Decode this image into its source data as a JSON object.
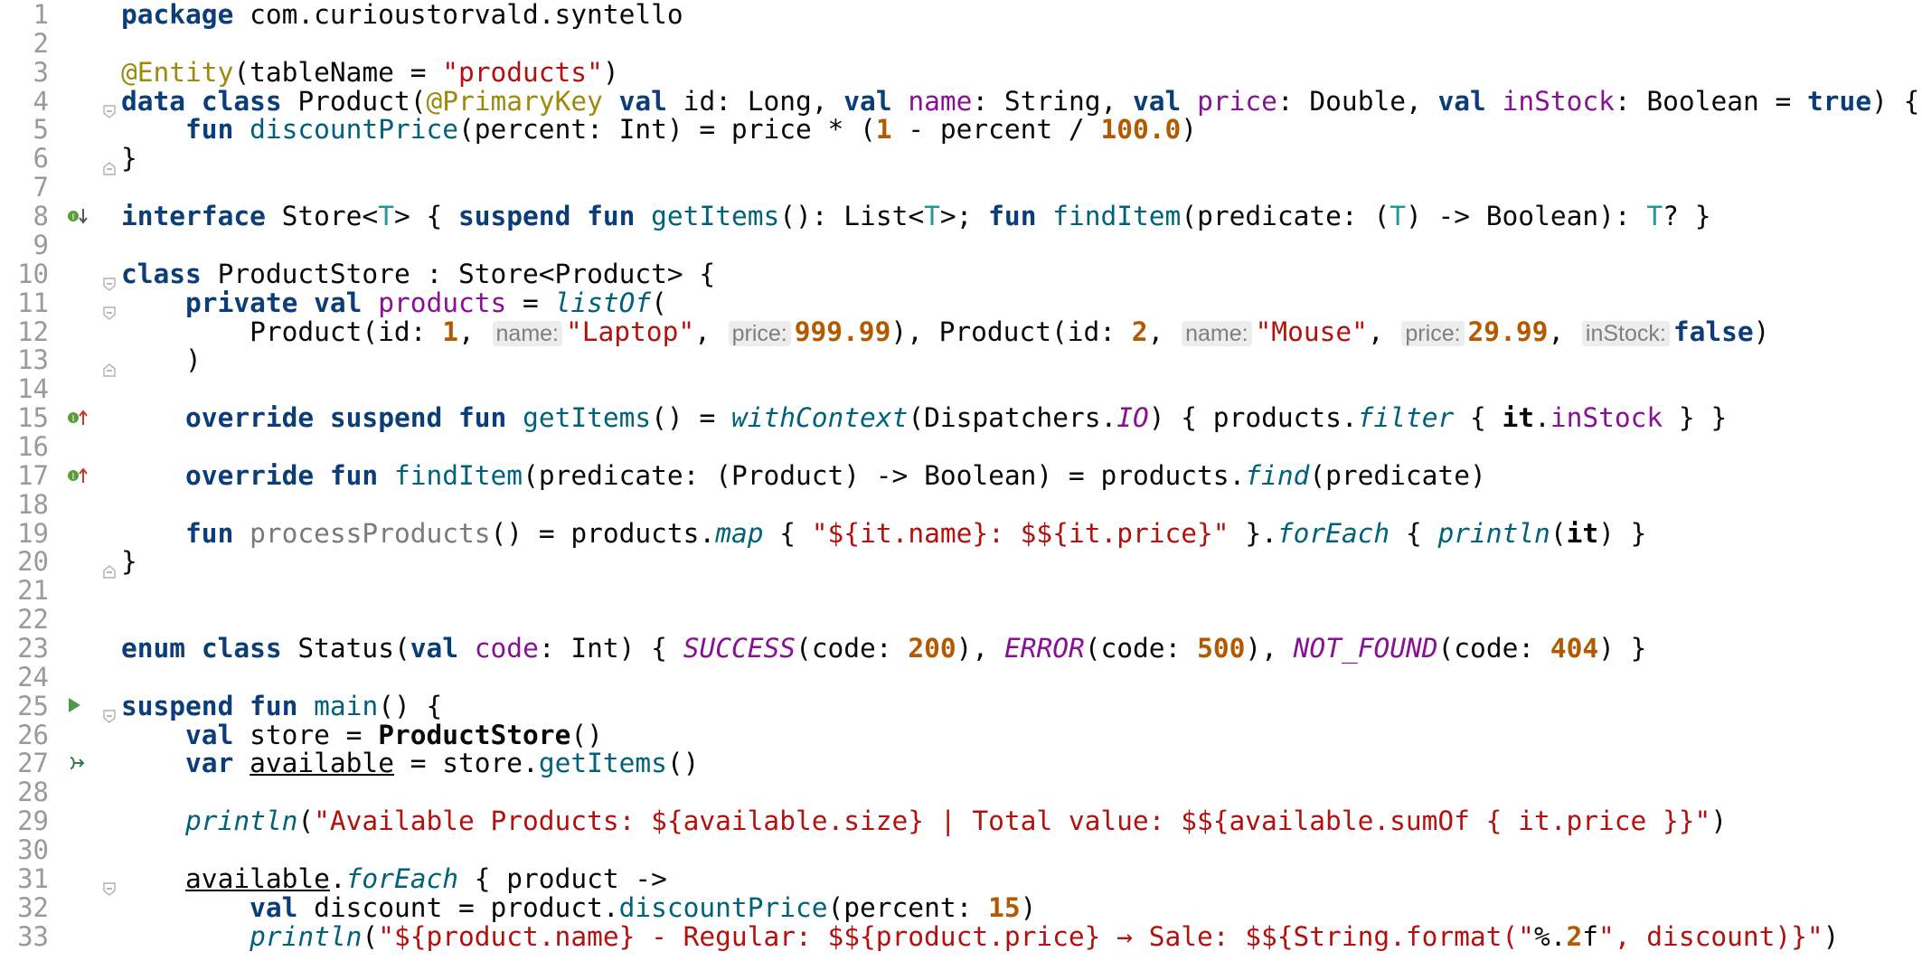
{
  "editor": {
    "language": "Kotlin",
    "colors": {
      "keyword": "#0b3d78",
      "function": "#00627a",
      "property": "#871094",
      "string": "#b2110d",
      "number": "#b35a00",
      "annotation": "#9e880d",
      "inlay_hint_bg": "#ededed"
    },
    "lines": [
      {
        "n": "1",
        "code": "package com.curioustorvald.syntello"
      },
      {
        "n": "2",
        "code": ""
      },
      {
        "n": "3",
        "code": "@Entity(tableName = \"products\")"
      },
      {
        "n": "4",
        "code": "data class Product(@PrimaryKey val id: Long, val name: String, val price: Double, val inStock: Boolean = true) {",
        "fold": "open"
      },
      {
        "n": "5",
        "code": "    fun discountPrice(percent: Int) = price * (1 - percent / 100.0)"
      },
      {
        "n": "6",
        "code": "}",
        "fold": "close"
      },
      {
        "n": "7",
        "code": ""
      },
      {
        "n": "8",
        "code": "interface Store<T> { suspend fun getItems(): List<T>; fun findItem(predicate: (T) -> Boolean): T? }",
        "gutter_icon": "implemented-icon"
      },
      {
        "n": "9",
        "code": ""
      },
      {
        "n": "10",
        "code": "class ProductStore : Store<Product> {",
        "fold": "open"
      },
      {
        "n": "11",
        "code": "    private val products = listOf(",
        "fold": "open"
      },
      {
        "n": "12",
        "code": "        Product(id: 1, name: \"Laptop\", price: 999.99), Product(id: 2, name: \"Mouse\", price: 29.99, inStock: false)"
      },
      {
        "n": "13",
        "code": "    )",
        "fold": "close"
      },
      {
        "n": "14",
        "code": ""
      },
      {
        "n": "15",
        "code": "    override suspend fun getItems() = withContext(Dispatchers.IO) { products.filter { it.inStock } }",
        "gutter_icon": "implements-icon"
      },
      {
        "n": "16",
        "code": ""
      },
      {
        "n": "17",
        "code": "    override fun findItem(predicate: (Product) -> Boolean) = products.find(predicate)",
        "gutter_icon": "implements-icon"
      },
      {
        "n": "18",
        "code": ""
      },
      {
        "n": "19",
        "code": "    fun processProducts() = products.map { \"${it.name}: $${it.price}\" }.forEach { println(it) }"
      },
      {
        "n": "20",
        "code": "}",
        "fold": "close"
      },
      {
        "n": "21",
        "code": ""
      },
      {
        "n": "22",
        "code": ""
      },
      {
        "n": "23",
        "code": "enum class Status(val code: Int) { SUCCESS(code: 200), ERROR(code: 500), NOT_FOUND(code: 404) }"
      },
      {
        "n": "24",
        "code": ""
      },
      {
        "n": "25",
        "code": "suspend fun main() {",
        "gutter_icon": "run-icon",
        "fold": "open"
      },
      {
        "n": "26",
        "code": "    val store = ProductStore()"
      },
      {
        "n": "27",
        "code": "    var available = store.getItems()",
        "gutter_icon": "suspend-call-icon"
      },
      {
        "n": "28",
        "code": ""
      },
      {
        "n": "29",
        "code": "    println(\"Available Products: ${available.size} | Total value: $${available.sumOf { it.price }}\")"
      },
      {
        "n": "30",
        "code": ""
      },
      {
        "n": "31",
        "code": "    available.forEach { product ->",
        "fold": "open"
      },
      {
        "n": "32",
        "code": "        val discount = product.discountPrice(percent: 15)"
      },
      {
        "n": "33",
        "code": "        println(\"${product.name} - Regular: $${product.price} → Sale: $${String.format(\"%.2f\", discount)}\")"
      }
    ]
  }
}
